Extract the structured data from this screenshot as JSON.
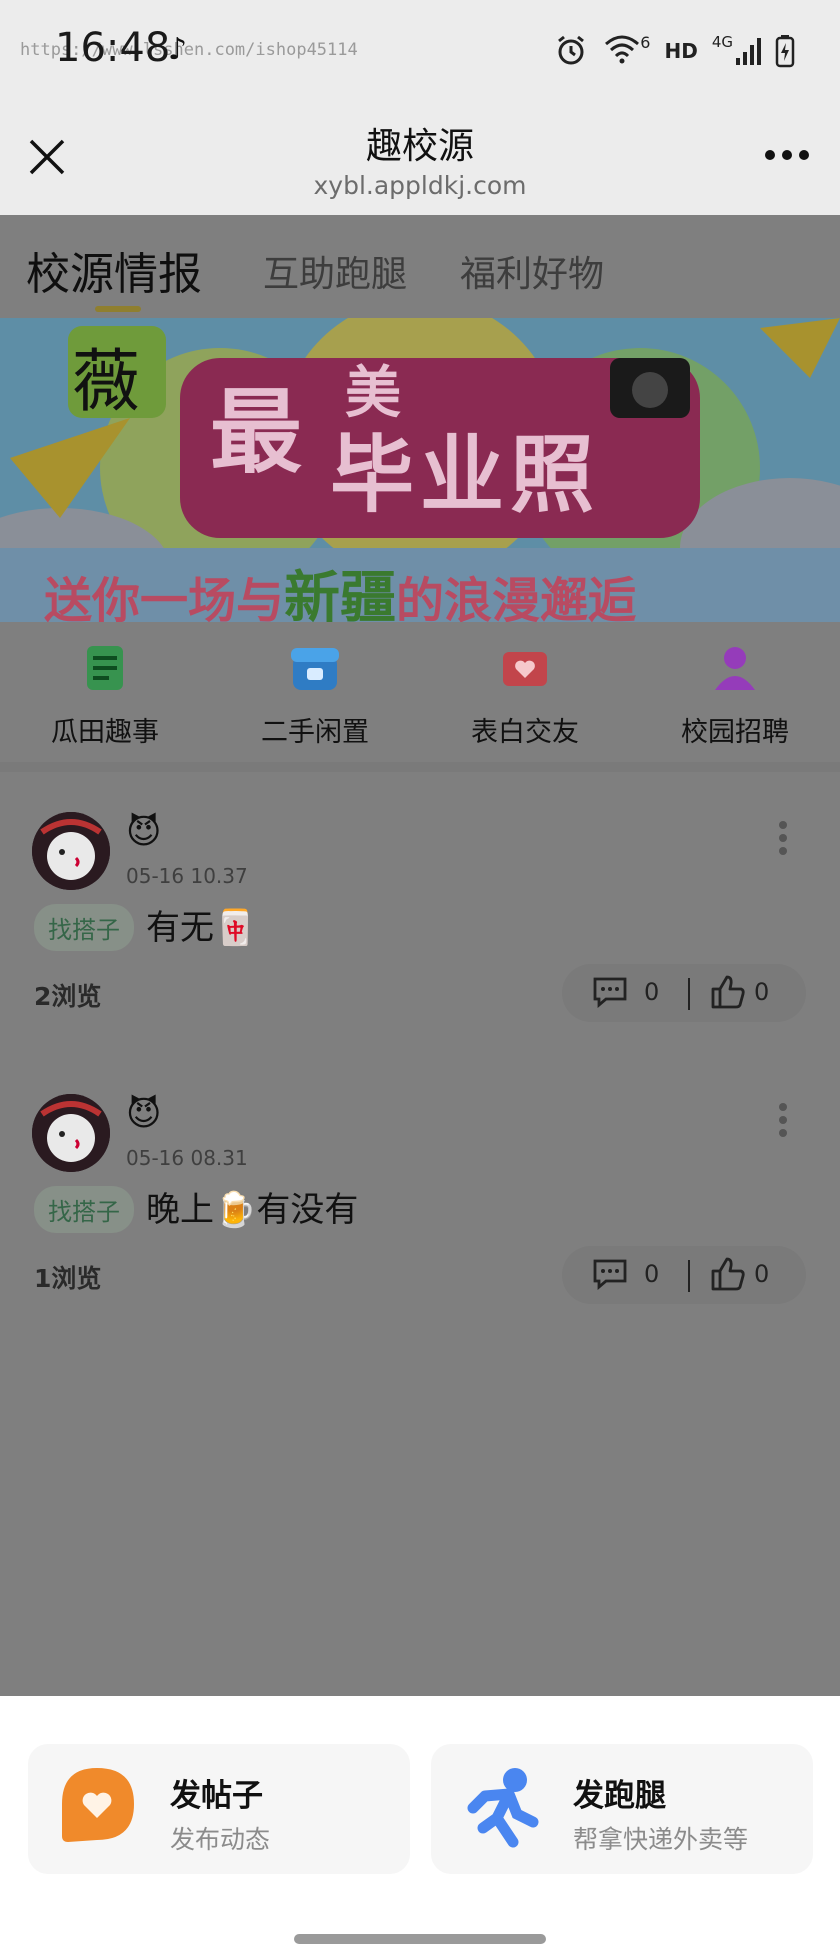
{
  "status_bar": {
    "time": "16:48",
    "watermark": "https://www.lsshen.com/ishop45114",
    "network_label": "HD",
    "signal_label": "4G",
    "wifi_badge": "6"
  },
  "header": {
    "title": "趣校源",
    "url": "xybl.appldkj.com"
  },
  "tabs": [
    {
      "label": "校源情报",
      "active": true
    },
    {
      "label": "互助跑腿",
      "active": false
    },
    {
      "label": "福利好物",
      "active": false
    }
  ],
  "banner": {
    "logo_char": "薇",
    "line1_a": "最",
    "line1_b": "美",
    "line2": "毕业照",
    "subtitle_a": "送你一场与",
    "subtitle_b": "新疆",
    "subtitle_c": "的浪漫邂逅"
  },
  "categories": [
    {
      "label": "瓜田趣事",
      "icon": "scroll-icon",
      "color": "#1f9a3f"
    },
    {
      "label": "二手闲置",
      "icon": "shop-icon",
      "color": "#1c7cd6"
    },
    {
      "label": "表白交友",
      "icon": "love-letter-icon",
      "color": "#d8323a"
    },
    {
      "label": "校园招聘",
      "icon": "person-icon",
      "color": "#9b2cc9"
    }
  ],
  "posts": [
    {
      "emoji": "😈",
      "time": "05-16  10.37",
      "tag": "找搭子",
      "text": "有无🀄",
      "views": "2浏览",
      "comments": "0",
      "likes": "0"
    },
    {
      "emoji": "😈",
      "time": "05-16  08.31",
      "tag": "找搭子",
      "text": "晚上🍺有没有",
      "views": "1浏览",
      "comments": "0",
      "likes": "0"
    }
  ],
  "sheet": {
    "cards": [
      {
        "title": "发帖子",
        "subtitle": "发布动态",
        "icon": "chat-heart-icon",
        "color": "#f08a2b"
      },
      {
        "title": "发跑腿",
        "subtitle": "帮拿快递外卖等",
        "icon": "runner-icon",
        "color": "#4a86f0"
      }
    ]
  }
}
